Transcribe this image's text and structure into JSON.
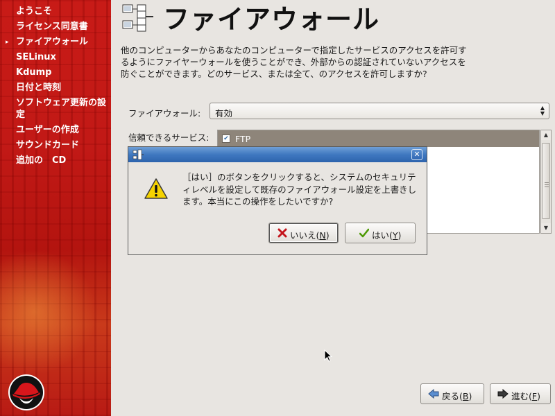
{
  "sidebar": {
    "items": [
      {
        "label": "ようこそ",
        "current": false
      },
      {
        "label": "ライセンス同意書",
        "current": false
      },
      {
        "label": "ファイアウォール",
        "current": true
      },
      {
        "label": "SELinux",
        "current": false
      },
      {
        "label": "Kdump",
        "current": false
      },
      {
        "label": "日付と時刻",
        "current": false
      },
      {
        "label": "ソフトウェア更新の設定",
        "current": false
      },
      {
        "label": "ユーザーの作成",
        "current": false
      },
      {
        "label": "サウンドカード",
        "current": false
      },
      {
        "label": "追加の　CD",
        "current": false
      }
    ],
    "current_marker": "▸"
  },
  "header": {
    "title": "ファイアウォール",
    "icon": "firewall-network-icon"
  },
  "main": {
    "description": "他のコンピューターからあなたのコンピューターで指定したサービスのアクセスを許可するようにファイヤーウォールを使うことができ、外部からの認証されていないアクセスを防ぐことができます。どのサービス、または全て、のアクセスを許可しますか?",
    "firewall_label": "ファイアウォール:",
    "firewall_value": "有効",
    "trusted_label": "信頼できるサービス:",
    "services": [
      {
        "name": "FTP",
        "checked": true
      }
    ]
  },
  "nav": {
    "back_label": "戻る(",
    "back_key": "B",
    "next_label": "進む(",
    "next_key": "F",
    "close_paren": ")"
  },
  "dialog": {
    "message": "［はい］のボタンをクリックすると、システムのセキュリティレベルを設定して既存のファイアウォール設定を上書きします。本当にこの操作をしたいですか?",
    "no_label": "いいえ(",
    "no_key": "N",
    "yes_label": "はい(",
    "yes_key": "Y",
    "close_paren": ")",
    "close_glyph": "✕"
  },
  "colors": {
    "sidebar": "#c41a17",
    "titlebar": "#3f78c0",
    "selection_row": "#8e857a",
    "window_bg": "#e8e5e1"
  }
}
